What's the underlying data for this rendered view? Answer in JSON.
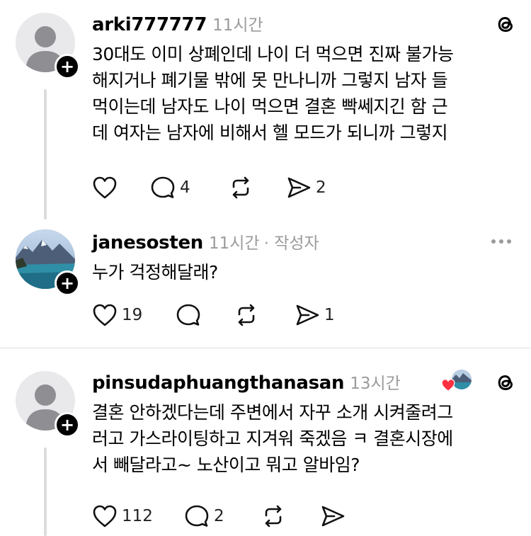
{
  "posts": [
    {
      "username": "arki777777",
      "time": "11시간",
      "lines": [
        "30대도 이미 상폐인데 나이 더 먹으면 진짜 불가능",
        "해지거나 폐기물 밖에 못 만나니까 그렇지 남자 들",
        "먹이는데 남자도 나이 먹으면 결혼 빡쎄지긴 함 근",
        "데 여자는 남자에 비해서 헬 모드가 되니까 그렇지"
      ],
      "likes": "",
      "replies": "4",
      "reposts": "",
      "shares": "2"
    },
    {
      "username": "janesosten",
      "time": "11시간",
      "author_tag": "· 작성자",
      "lines": [
        "누가 걱정해달래?"
      ],
      "likes": "19",
      "replies": "",
      "reposts": "",
      "shares": "1"
    },
    {
      "username": "pinsudaphuangthanasan",
      "time": "13시간",
      "lines": [
        "결혼 안하겠다는데 주변에서 자꾸 소개 시켜줄려그",
        "러고 가스라이팅하고 지겨워 죽겠음 ㅋ 결혼시장에",
        "서 빼달라고~ 노산이고 뭐고 알바임?"
      ],
      "likes": "112",
      "replies": "2",
      "reposts": "",
      "shares": ""
    }
  ],
  "icons": {
    "heart": "heart-icon",
    "reply": "reply-bubble-icon",
    "repost": "repost-icon",
    "share": "share-send-icon",
    "threads": "threads-logo-icon",
    "plus": "follow-plus-icon",
    "more": "more-options-icon"
  },
  "colors": {
    "liked_heart": "#ff3040",
    "meta_gray": "#9b9b9b",
    "text": "#000000"
  }
}
